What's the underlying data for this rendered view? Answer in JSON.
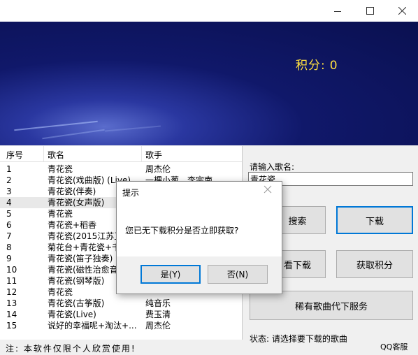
{
  "score": {
    "label": "积分:",
    "value": "0"
  },
  "list": {
    "headers": [
      "序号",
      "歌名",
      "歌手"
    ],
    "rows": [
      {
        "no": "1",
        "name": "青花瓷",
        "singer": "周杰伦"
      },
      {
        "no": "2",
        "name": "青花瓷(戏曲版) (Live)",
        "singer": "一棵小葱、李宗南"
      },
      {
        "no": "3",
        "name": "青花瓷(伴奏)",
        "singer": ""
      },
      {
        "no": "4",
        "name": "青花瓷(女声版)",
        "singer": ""
      },
      {
        "no": "5",
        "name": "青花瓷",
        "singer": ""
      },
      {
        "no": "6",
        "name": "青花瓷+稻香",
        "singer": ""
      },
      {
        "no": "7",
        "name": "青花瓷(2015江苏卫",
        "singer": ""
      },
      {
        "no": "8",
        "name": "菊花台+青花瓷+千",
        "singer": ""
      },
      {
        "no": "9",
        "name": "青花瓷(笛子独奏)",
        "singer": ""
      },
      {
        "no": "10",
        "name": "青花瓷(磁性治愈音",
        "singer": ""
      },
      {
        "no": "11",
        "name": "青花瓷(钢琴版)",
        "singer": ""
      },
      {
        "no": "12",
        "name": "青花瓷",
        "singer": ""
      },
      {
        "no": "13",
        "name": "青花瓷(古筝版)",
        "singer": "纯音乐"
      },
      {
        "no": "14",
        "name": "青花瓷(Live)",
        "singer": "费玉清"
      },
      {
        "no": "15",
        "name": "说好的幸福呢+淘汰+...",
        "singer": "周杰伦"
      }
    ]
  },
  "panel": {
    "input_label": "请输入歌名:",
    "input_value": "青花瓷",
    "search_btn": "搜索",
    "download_btn": "下载",
    "view_download_btn": "看下载",
    "get_points_btn": "获取积分",
    "rare_btn": "稀有歌曲代下服务",
    "status": "状态: 请选择要下载的歌曲",
    "qq": "QQ客服"
  },
  "note": "注: 本软件仅限个人欣赏使用!",
  "dialog": {
    "title": "提示",
    "message": "您已无下载积分是否立即获取?",
    "yes": "是(Y)",
    "no": "否(N)"
  }
}
